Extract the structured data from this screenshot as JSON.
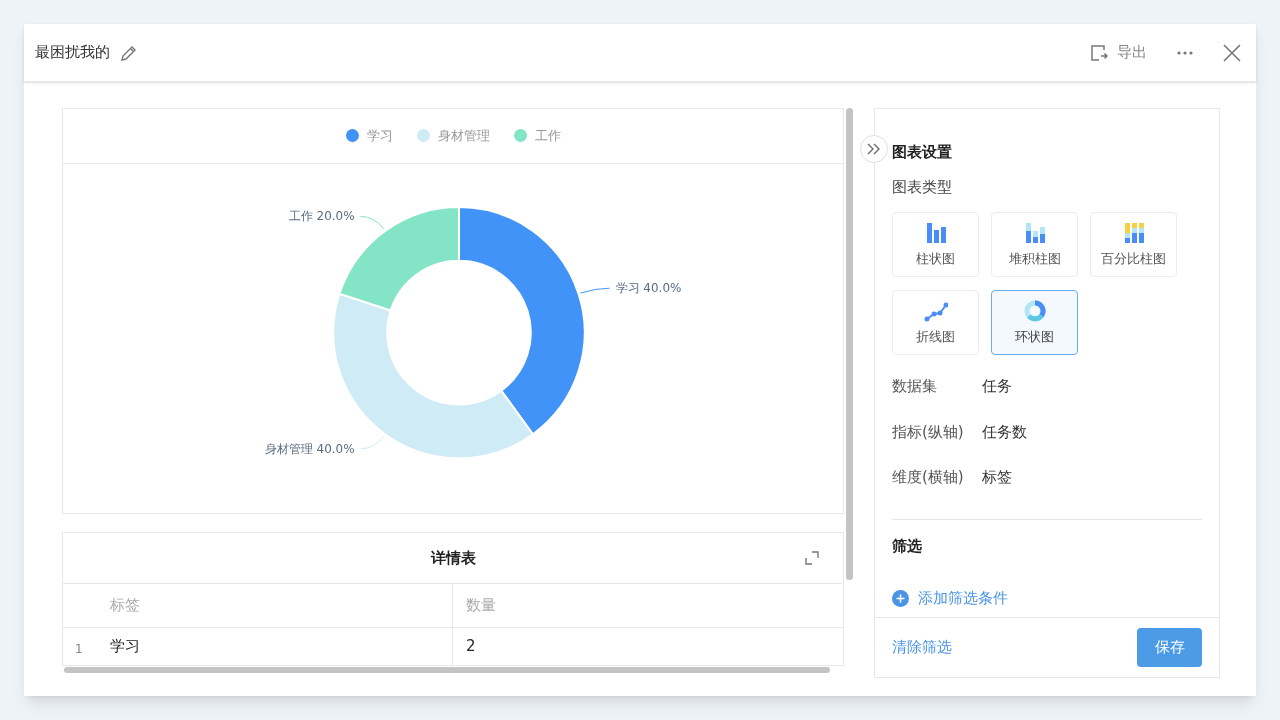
{
  "dialog": {
    "title": "最困扰我的",
    "actions": [
      {
        "kind": "export",
        "label": "导出"
      },
      {
        "kind": "more"
      },
      {
        "kind": "close"
      }
    ]
  },
  "chart_panel": {
    "legend": [
      {
        "color": "#4193f7"
      },
      {
        "color": "#cfebf5"
      },
      {
        "color": "#83e5c6"
      }
    ],
    "chart_data": {
      "type": "donut",
      "categories": [
        "学习",
        "身材管理",
        "工作"
      ],
      "values": [
        40,
        40,
        20
      ],
      "value_labels": [
        "学习 40.0%",
        "身材管理 40.0%",
        "工作 20.0%"
      ]
    }
  },
  "detail_table": {
    "title": "详情表",
    "columns": [
      "标签",
      "数量"
    ],
    "rows": [
      {
        "index": "1",
        "cells": [
          "学习",
          "2"
        ]
      }
    ]
  },
  "settings": {
    "title": "图表设置",
    "chart_type_label": "图表类型",
    "chart_types": [
      {
        "kind": "bar",
        "label": "柱状图",
        "selected": false
      },
      {
        "kind": "stacked",
        "label": "堆积柱图",
        "selected": false
      },
      {
        "kind": "percent",
        "label": "百分比柱图",
        "selected": false
      },
      {
        "kind": "line",
        "label": "折线图",
        "selected": false
      },
      {
        "kind": "donut",
        "label": "环状图",
        "selected": true
      }
    ],
    "fields": [
      {
        "label": "数据集",
        "value": "任务"
      },
      {
        "label": "指标(纵轴)",
        "value": "任务数"
      },
      {
        "label": "维度(横轴)",
        "value": "标签"
      }
    ],
    "filter_title": "筛选",
    "add_filter": "添加筛选条件",
    "clear_filter": "清除筛选",
    "save": "保存"
  }
}
